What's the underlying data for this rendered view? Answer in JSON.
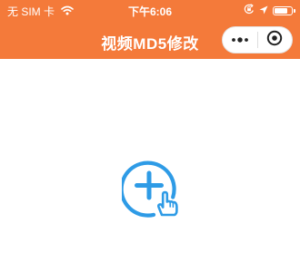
{
  "status_bar": {
    "carrier": "无 SIM 卡",
    "wifi_icon": "wifi-icon",
    "time": "下午6:06",
    "lock_icon": "orientation-lock-icon",
    "location_icon": "location-icon",
    "battery_icon": "battery-icon",
    "battery_level": 0.8
  },
  "navbar": {
    "title": "视频MD5修改",
    "more_icon": "more-icon",
    "close_icon": "close-icon"
  },
  "main": {
    "add_icon": "add-video-tap-icon"
  },
  "colors": {
    "header_bg": "#F47A3A",
    "accent": "#2E9BE6",
    "text_on_header": "#FFFFFF"
  }
}
